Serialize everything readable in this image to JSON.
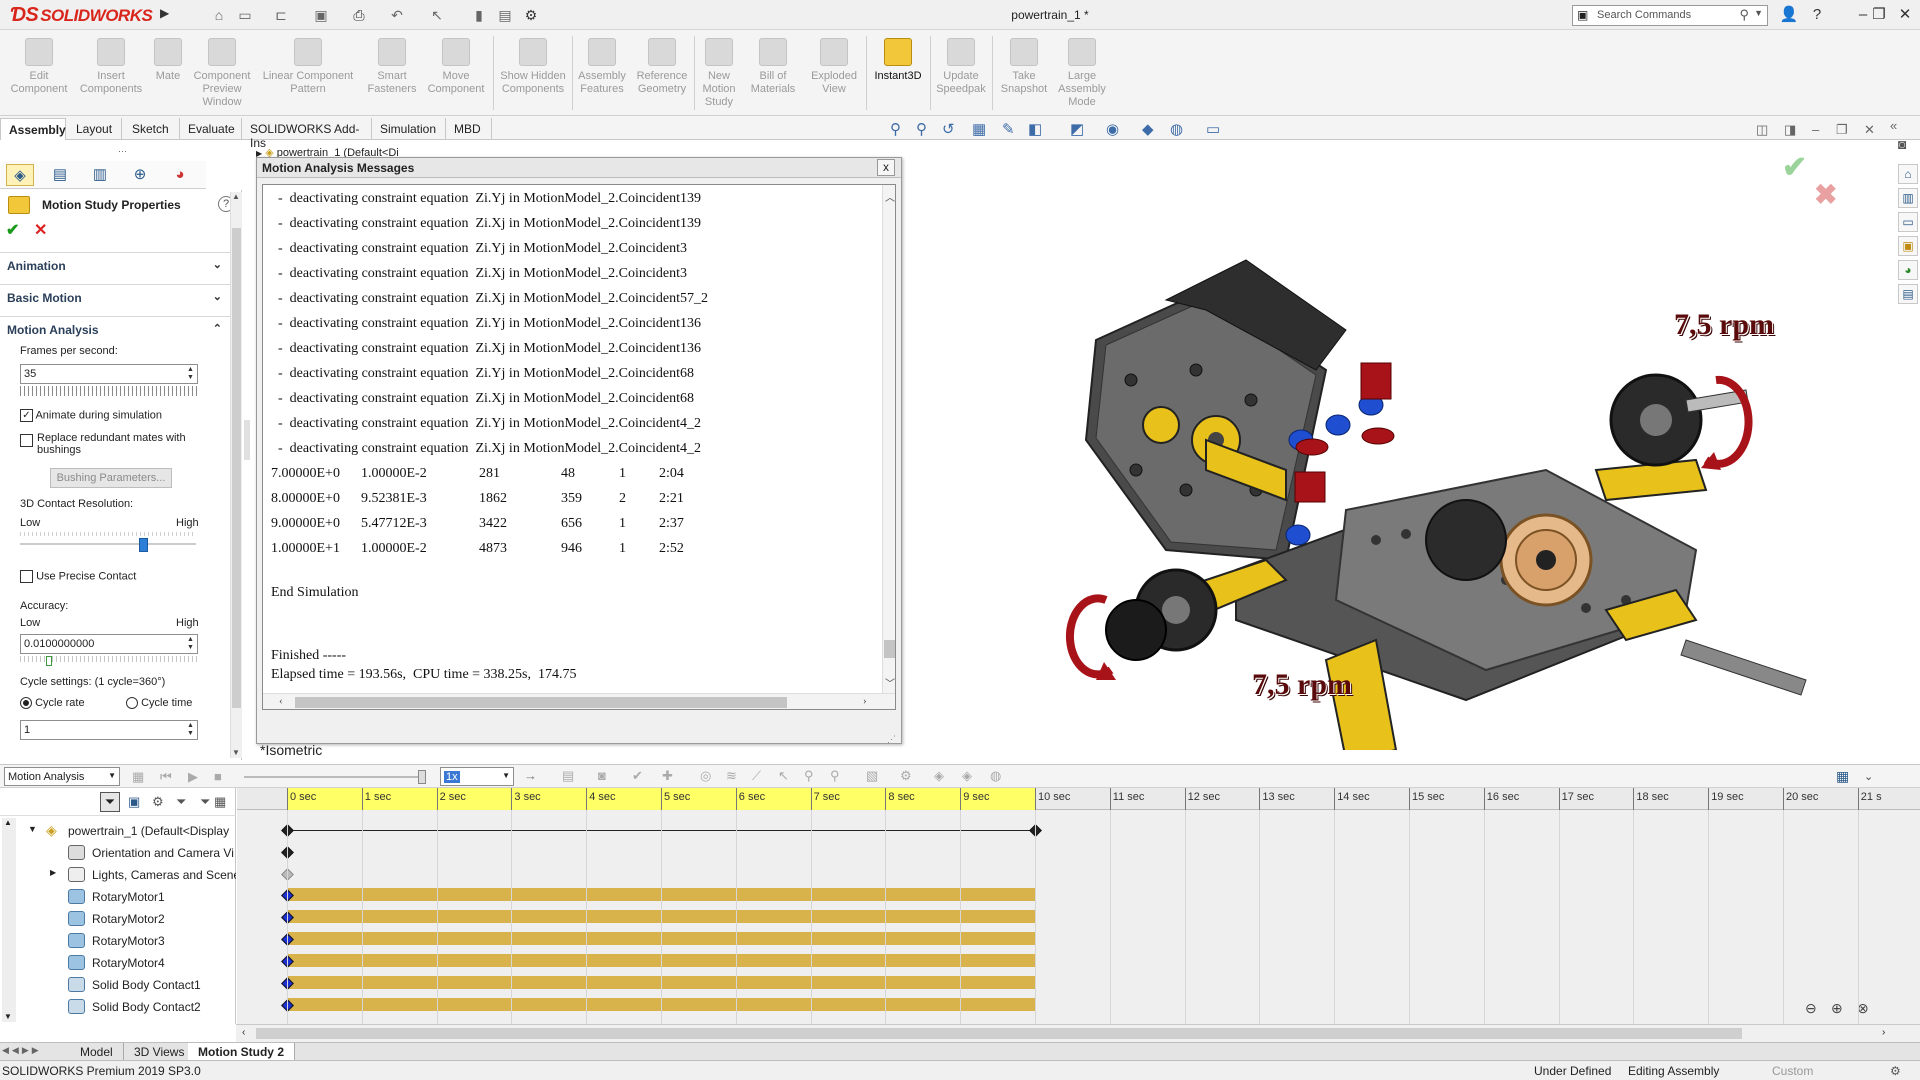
{
  "app": {
    "brand": "SOLIDWORKS",
    "doc_title": "powertrain_1 *"
  },
  "search": {
    "placeholder": "Search Commands"
  },
  "ribbon": [
    {
      "label": "Edit Component",
      "icon": "edit-component-icon"
    },
    {
      "label": "Insert Components",
      "icon": "insert-components-icon"
    },
    {
      "label": "Mate",
      "icon": "mate-icon"
    },
    {
      "label": "Component Preview Window",
      "icon": "preview-window-icon"
    },
    {
      "label": "Linear Component Pattern",
      "icon": "pattern-icon"
    },
    {
      "label": "Smart Fasteners",
      "icon": "fastener-icon"
    },
    {
      "label": "Move Component",
      "icon": "move-component-icon"
    },
    {
      "label": "Show Hidden Components",
      "icon": "show-hidden-icon"
    },
    {
      "label": "Assembly Features",
      "icon": "assembly-features-icon"
    },
    {
      "label": "Reference Geometry",
      "icon": "reference-geometry-icon"
    },
    {
      "label": "New Motion Study",
      "icon": "motion-study-icon"
    },
    {
      "label": "Bill of Materials",
      "icon": "bom-icon"
    },
    {
      "label": "Exploded View",
      "icon": "exploded-view-icon"
    },
    {
      "label": "Instant3D",
      "icon": "instant3d-icon"
    },
    {
      "label": "Update Speedpak",
      "icon": "speedpak-icon"
    },
    {
      "label": "Take Snapshot",
      "icon": "snapshot-icon"
    },
    {
      "label": "Large Assembly Mode",
      "icon": "large-assembly-icon"
    }
  ],
  "tabs": [
    "Assembly",
    "Layout",
    "Sketch",
    "Evaluate",
    "SOLIDWORKS Add-Ins",
    "Simulation",
    "MBD"
  ],
  "pm": {
    "title": "Motion Study Properties",
    "sections": {
      "animation": "Animation",
      "basic": "Basic Motion",
      "analysis": "Motion Analysis"
    },
    "fps_label": "Frames per second:",
    "fps_value": "35",
    "animate_label": "Animate during simulation",
    "replace_label": "Replace redundant mates with bushings",
    "bushing_btn": "Bushing Parameters...",
    "contact_res_label": "3D Contact Resolution:",
    "low": "Low",
    "high": "High",
    "precise_label": "Use Precise Contact",
    "accuracy_label": "Accuracy:",
    "accuracy_value": "0.0100000000",
    "cycle_label": "Cycle settings: (1 cycle=360°)",
    "cycle_rate": "Cycle rate",
    "cycle_time": "Cycle time",
    "cycle_value": "1",
    "contact_slider_level": 0.7,
    "accuracy_slider_level": 0.15
  },
  "dialog": {
    "title": "Motion Analysis Messages",
    "close": "x",
    "lines": [
      "  -  deactivating constraint equation  Zi.Yj in MotionModel_2.Coincident139",
      "  -  deactivating constraint equation  Zi.Xj in MotionModel_2.Coincident139",
      "  -  deactivating constraint equation  Zi.Yj in MotionModel_2.Coincident3",
      "  -  deactivating constraint equation  Zi.Xj in MotionModel_2.Coincident3",
      "  -  deactivating constraint equation  Zi.Xj in MotionModel_2.Coincident57_2",
      "  -  deactivating constraint equation  Zi.Yj in MotionModel_2.Coincident136",
      "  -  deactivating constraint equation  Zi.Xj in MotionModel_2.Coincident136",
      "  -  deactivating constraint equation  Zi.Yj in MotionModel_2.Coincident68",
      "  -  deactivating constraint equation  Zi.Xj in MotionModel_2.Coincident68",
      "  -  deactivating constraint equation  Zi.Yj in MotionModel_2.Coincident4_2",
      "  -  deactivating constraint equation  Zi.Xj in MotionModel_2.Coincident4_2"
    ],
    "table": [
      [
        "7.00000E+0",
        "1.00000E-2",
        "281",
        "48",
        "1",
        "2:04"
      ],
      [
        "8.00000E+0",
        "9.52381E-3",
        "1862",
        "359",
        "2",
        "2:21"
      ],
      [
        "9.00000E+0",
        "5.47712E-3",
        "3422",
        "656",
        "1",
        "2:37"
      ],
      [
        "1.00000E+1",
        "1.00000E-2",
        "4873",
        "946",
        "1",
        "2:52"
      ]
    ],
    "end": "End Simulation",
    "finished": "Finished -----",
    "elapsed": "Elapsed time = 193.56s,  CPU time = 338.25s,  174.75"
  },
  "view": {
    "label": "*Isometric",
    "rpm_top": "7,5 rpm",
    "rpm_bottom": "7,5 rpm",
    "tree_crumb": "powertrain_1 (Default<Di"
  },
  "motion": {
    "type": "Motion Analysis",
    "speed": "1x",
    "ticks": [
      "0 sec",
      "1 sec",
      "2 sec",
      "3 sec",
      "4 sec",
      "5 sec",
      "6 sec",
      "7 sec",
      "8 sec",
      "9 sec",
      "10 sec",
      "11 sec",
      "12 sec",
      "13 sec",
      "14 sec",
      "15 sec",
      "16 sec",
      "17 sec",
      "18 sec",
      "19 sec",
      "20 sec",
      "21 s"
    ],
    "tree": [
      "powertrain_1  (Default<Display",
      "Orientation and Camera Vi",
      "Lights, Cameras and Scene",
      "RotaryMotor1",
      "RotaryMotor2",
      "RotaryMotor3",
      "RotaryMotor4",
      "Solid Body Contact1",
      "Solid Body Contact2"
    ]
  },
  "bottom_tabs": [
    "Model",
    "3D Views",
    "Motion Study 2"
  ],
  "status": {
    "left": "SOLIDWORKS Premium 2019 SP3.0",
    "defined": "Under Defined",
    "editing": "Editing Assembly",
    "custom": "Custom"
  }
}
